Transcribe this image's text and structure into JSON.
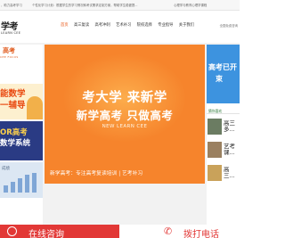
{
  "topbar": {
    "items": [
      "，助力高考学习",
      "个性化学习计划：根据学生的学习情况和考试需求定制方案，帮助学生稳健提...",
      "心理学与教育心理学课程"
    ]
  },
  "header": {
    "logo_text": "学考",
    "logo_sub": "LEARN CEE",
    "nav": [
      "首页",
      "高三复读",
      "高考冲刺",
      "艺术补习",
      "院校选择",
      "专业指导",
      "关于我们"
    ],
    "phone": "全国免费咨询"
  },
  "left_tiles": {
    "tile1_title": "高考",
    "tile1_sub": "CEE FOCUS",
    "tile2_line1": "能数学",
    "tile2_line2": "一辅导",
    "tile3_line1": "OR高考",
    "tile3_line2": "数学系统",
    "tile4_title": "成绩"
  },
  "hero": {
    "line1": "考大学 来新学",
    "line2": "新学高考 只做高考",
    "line3": "NEW LEARN CEE",
    "caption": "新学高考：专注高考复读培训 | 艺考补习"
  },
  "right_col": {
    "ad_line1": "高考已开",
    "ad_line2": "束",
    "section_head": "猜你喜欢",
    "items": [
      "高三多...",
      "艺考课...",
      "高三..."
    ]
  },
  "actions": {
    "consult_label": "在线咨询",
    "call_label": "拨打电话"
  },
  "colors": {
    "accent": "#e23836",
    "hero": "#f6842c",
    "brand": "#f0862e",
    "side_blue": "#3d93df"
  }
}
